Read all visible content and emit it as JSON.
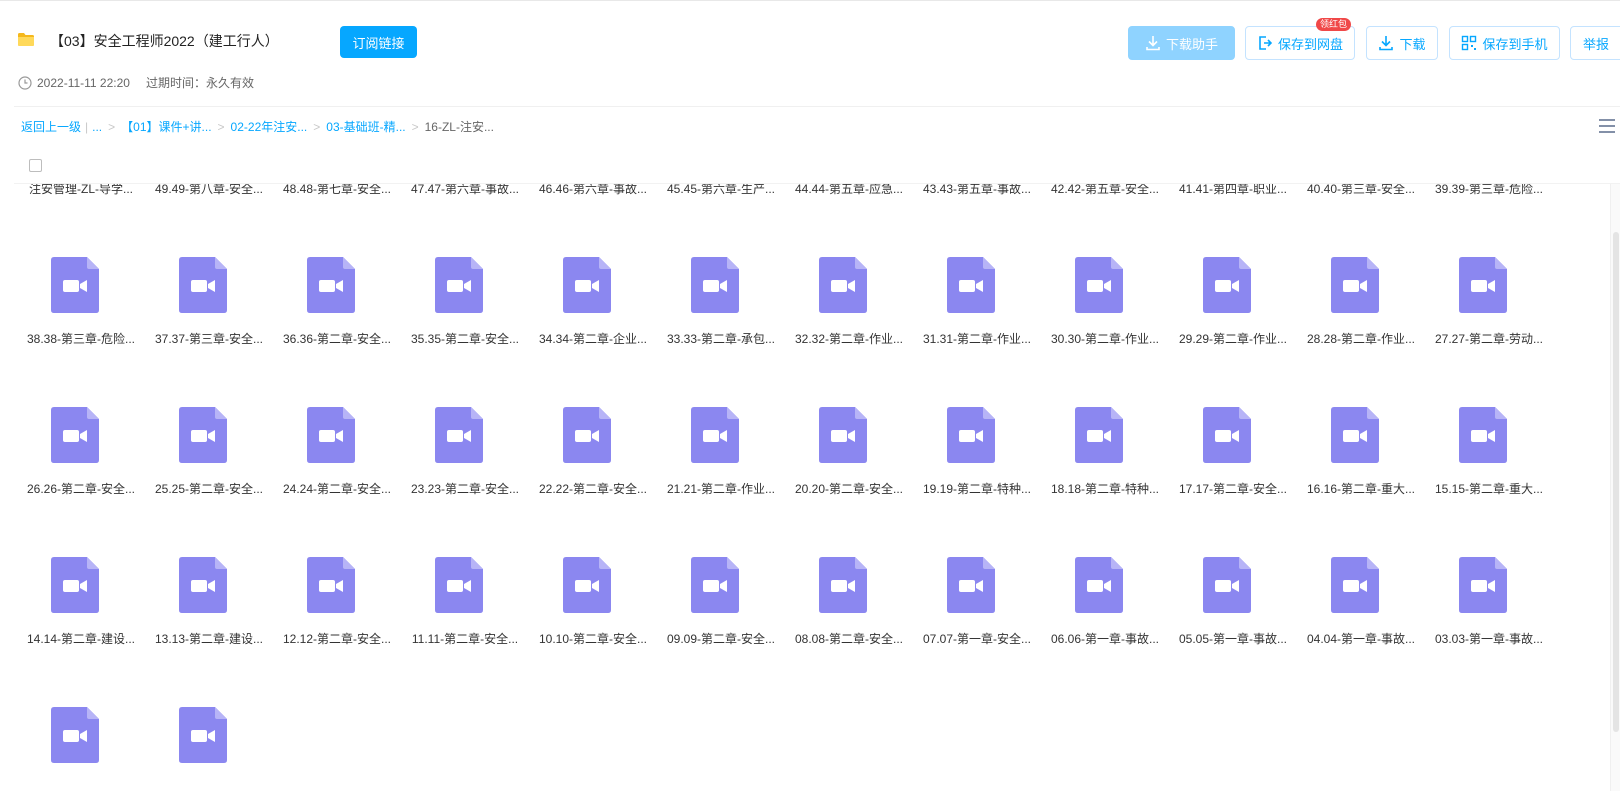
{
  "share": {
    "title": "【03】安全工程师2022（建工行人）",
    "subscribe_label": "订阅链接",
    "created": "2022-11-11 22:20",
    "expire_label": "过期时间：",
    "expire_value": "永久有效"
  },
  "actions": {
    "download_helper": "下载助手",
    "save_to_netdisk": "保存到网盘",
    "badge": "领红包",
    "download": "下载",
    "save_to_phone": "保存到手机",
    "report": "举报"
  },
  "breadcrumb": {
    "back": "返回上一级",
    "ellipsis": "...",
    "crumbs": [
      "【01】课件+讲...",
      "02-22年注安...",
      "03-基础班-精..."
    ],
    "current": "16-ZL-注安..."
  },
  "colors": {
    "accent": "#06a7ff",
    "video_icon": "#8b87f0",
    "folder_icon": "#ffd95a"
  },
  "files": [
    {
      "name": "注安管理-ZL-导学...",
      "type": "folder"
    },
    {
      "name": "49.49-第八章-安全...",
      "type": "video"
    },
    {
      "name": "48.48-第七章-安全...",
      "type": "video"
    },
    {
      "name": "47.47-第六章-事故...",
      "type": "video"
    },
    {
      "name": "46.46-第六章-事故...",
      "type": "video"
    },
    {
      "name": "45.45-第六章-生产...",
      "type": "video"
    },
    {
      "name": "44.44-第五章-应急...",
      "type": "video"
    },
    {
      "name": "43.43-第五章-事故...",
      "type": "video"
    },
    {
      "name": "42.42-第五章-安全...",
      "type": "video"
    },
    {
      "name": "41.41-第四章-职业...",
      "type": "video"
    },
    {
      "name": "40.40-第三章-安全...",
      "type": "video"
    },
    {
      "name": "39.39-第三章-危险...",
      "type": "video"
    },
    {
      "name": "38.38-第三章-危险...",
      "type": "video"
    },
    {
      "name": "37.37-第三章-安全...",
      "type": "video"
    },
    {
      "name": "36.36-第二章-安全...",
      "type": "video"
    },
    {
      "name": "35.35-第二章-安全...",
      "type": "video"
    },
    {
      "name": "34.34-第二章-企业...",
      "type": "video"
    },
    {
      "name": "33.33-第二章-承包...",
      "type": "video"
    },
    {
      "name": "32.32-第二章-作业...",
      "type": "video"
    },
    {
      "name": "31.31-第二章-作业...",
      "type": "video"
    },
    {
      "name": "30.30-第二章-作业...",
      "type": "video"
    },
    {
      "name": "29.29-第二章-作业...",
      "type": "video"
    },
    {
      "name": "28.28-第二章-作业...",
      "type": "video"
    },
    {
      "name": "27.27-第二章-劳动...",
      "type": "video"
    },
    {
      "name": "26.26-第二章-安全...",
      "type": "video"
    },
    {
      "name": "25.25-第二章-安全...",
      "type": "video"
    },
    {
      "name": "24.24-第二章-安全...",
      "type": "video"
    },
    {
      "name": "23.23-第二章-安全...",
      "type": "video"
    },
    {
      "name": "22.22-第二章-安全...",
      "type": "video"
    },
    {
      "name": "21.21-第二章-作业...",
      "type": "video"
    },
    {
      "name": "20.20-第二章-安全...",
      "type": "video"
    },
    {
      "name": "19.19-第二章-特种...",
      "type": "video"
    },
    {
      "name": "18.18-第二章-特种...",
      "type": "video"
    },
    {
      "name": "17.17-第二章-安全...",
      "type": "video"
    },
    {
      "name": "16.16-第二章-重大...",
      "type": "video"
    },
    {
      "name": "15.15-第二章-重大...",
      "type": "video"
    },
    {
      "name": "14.14-第二章-建设...",
      "type": "video"
    },
    {
      "name": "13.13-第二章-建设...",
      "type": "video"
    },
    {
      "name": "12.12-第二章-安全...",
      "type": "video"
    },
    {
      "name": "11.11-第二章-安全...",
      "type": "video"
    },
    {
      "name": "10.10-第二章-安全...",
      "type": "video"
    },
    {
      "name": "09.09-第二章-安全...",
      "type": "video"
    },
    {
      "name": "08.08-第二章-安全...",
      "type": "video"
    },
    {
      "name": "07.07-第一章-安全...",
      "type": "video"
    },
    {
      "name": "06.06-第一章-事故...",
      "type": "video"
    },
    {
      "name": "05.05-第一章-事故...",
      "type": "video"
    },
    {
      "name": "04.04-第一章-事故...",
      "type": "video"
    },
    {
      "name": "03.03-第一章-事故...",
      "type": "video"
    },
    {
      "name": "",
      "type": "video"
    },
    {
      "name": "",
      "type": "video"
    }
  ]
}
